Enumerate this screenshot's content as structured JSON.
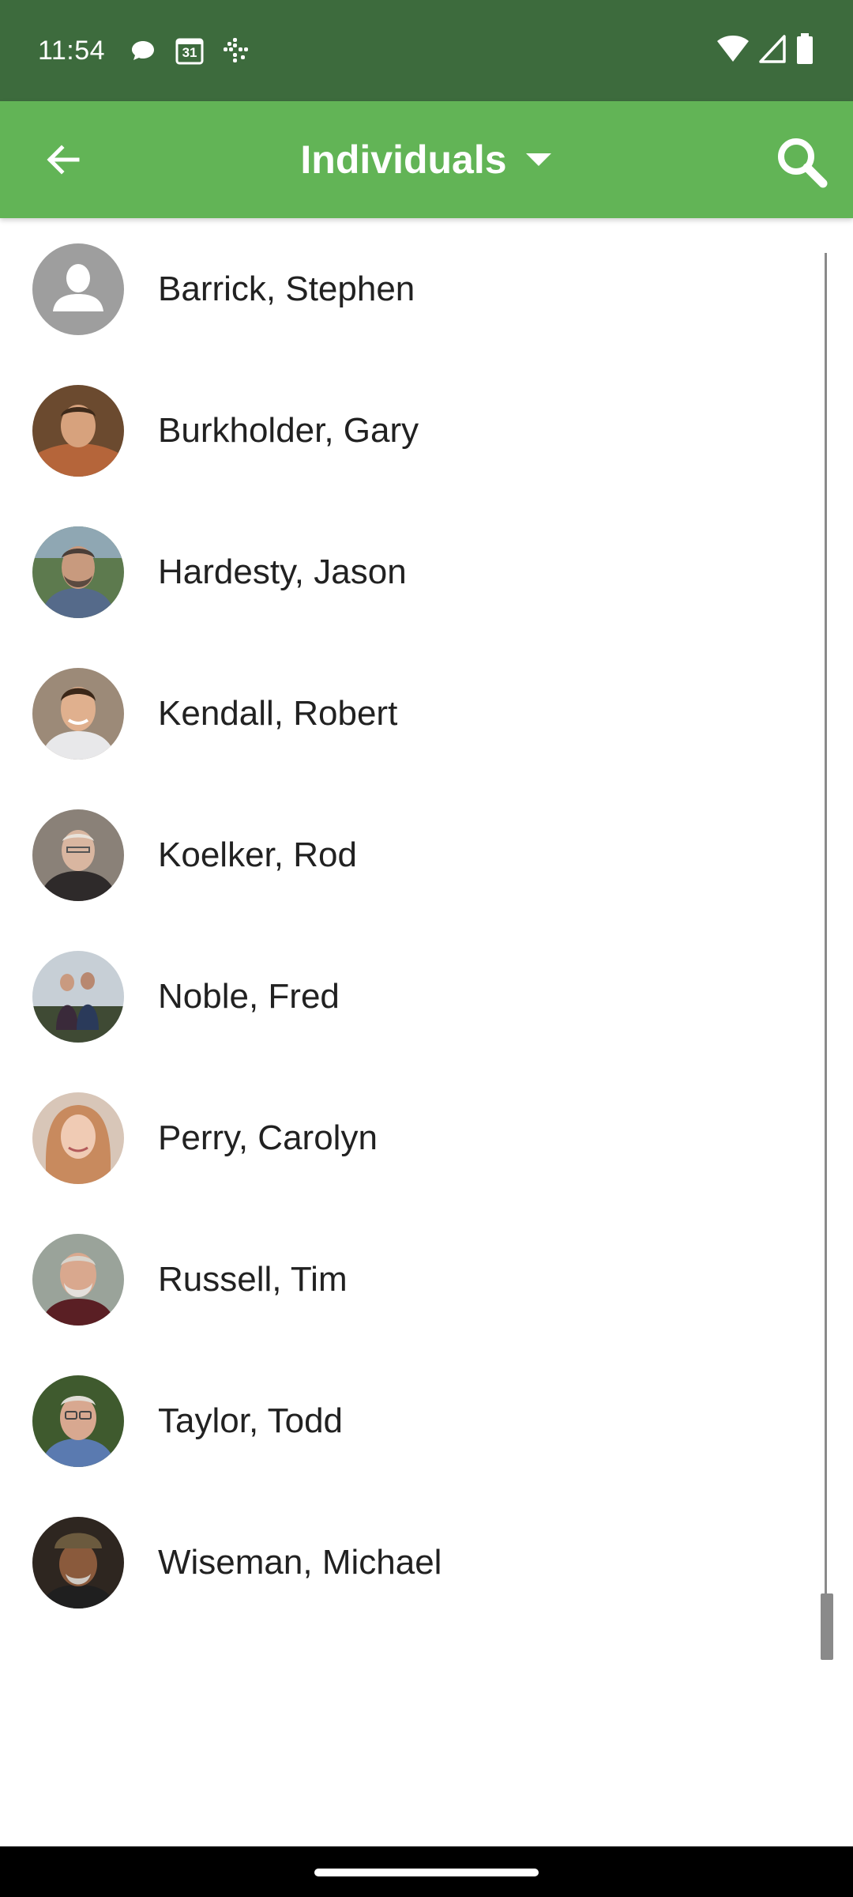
{
  "status_bar": {
    "time": "11:54",
    "calendar_day": "31",
    "notification_icons": [
      "chat-bubble-icon",
      "calendar-icon",
      "slack-icon"
    ],
    "system_icons": [
      "wifi-icon",
      "cell-signal-icon",
      "battery-icon"
    ]
  },
  "app_bar": {
    "title": "Individuals",
    "background_color": "#62b456",
    "icons": [
      "back-arrow-icon",
      "dropdown-caret-icon",
      "search-icon"
    ]
  },
  "people": [
    {
      "name": "Barrick, Stephen",
      "avatar": "placeholder-person-icon"
    },
    {
      "name": "Burkholder, Gary",
      "avatar": "photo"
    },
    {
      "name": "Hardesty, Jason",
      "avatar": "photo"
    },
    {
      "name": "Kendall, Robert",
      "avatar": "photo"
    },
    {
      "name": "Koelker, Rod",
      "avatar": "photo"
    },
    {
      "name": "Noble, Fred",
      "avatar": "photo"
    },
    {
      "name": "Perry, Carolyn",
      "avatar": "photo"
    },
    {
      "name": "Russell, Tim",
      "avatar": "photo"
    },
    {
      "name": "Taylor, Todd",
      "avatar": "photo"
    },
    {
      "name": "Wiseman, Michael",
      "avatar": "photo"
    }
  ],
  "scroll_position": 1.0,
  "colors": {
    "status_bar": "#3d6b3d",
    "app_bar": "#62b456",
    "text": "#212121"
  }
}
